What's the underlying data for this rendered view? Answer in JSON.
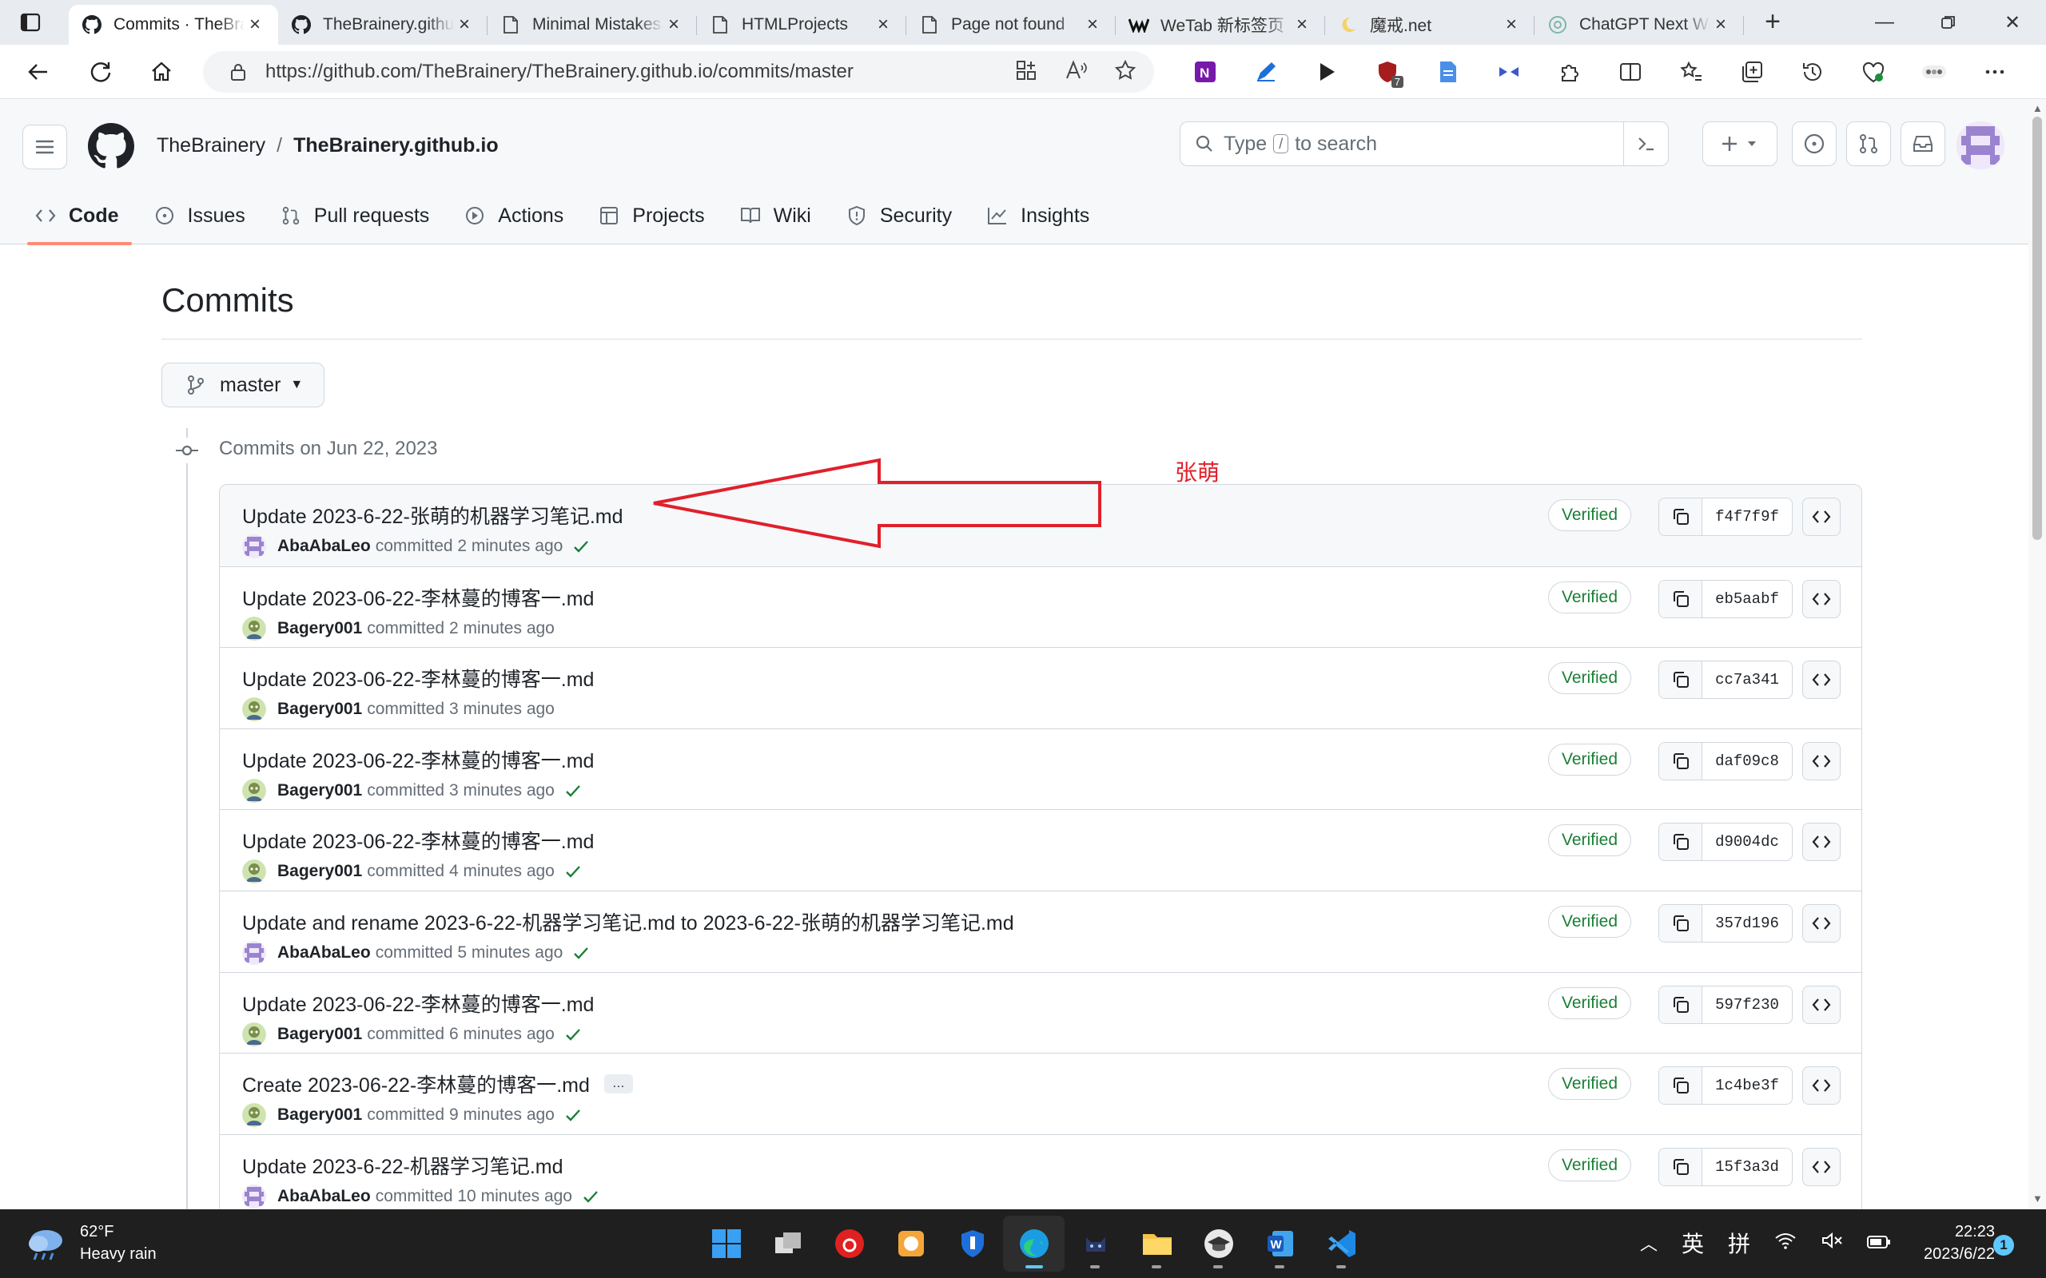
{
  "browser": {
    "tabs": [
      {
        "title": "Commits · TheBrainery/TheBrainery.github.io",
        "icon": "github-icon",
        "active": true
      },
      {
        "title": "TheBrainery.github.io",
        "icon": "github-icon",
        "active": false
      },
      {
        "title": "Minimal Mistakes",
        "icon": "page-icon",
        "active": false
      },
      {
        "title": "HTMLProjects",
        "icon": "page-icon",
        "active": false
      },
      {
        "title": "Page not found",
        "icon": "page-icon",
        "active": false
      },
      {
        "title": "WeTab 新标签页",
        "icon": "wetab-icon",
        "active": false
      },
      {
        "title": "魔戒.net",
        "icon": "moon-icon",
        "active": false
      },
      {
        "title": "ChatGPT Next Web",
        "icon": "chatgpt-icon",
        "active": false
      }
    ],
    "url": "https://github.com/TheBrainery/TheBrainery.github.io/commits/master",
    "extension_badge": "7"
  },
  "github": {
    "owner": "TheBrainery",
    "separator": "/",
    "repo": "TheBrainery.github.io",
    "search": {
      "prefix": "Type",
      "key": "/",
      "suffix": "to search"
    },
    "nav": [
      {
        "label": "Code",
        "icon": "code-icon",
        "active": true
      },
      {
        "label": "Issues",
        "icon": "issue-icon",
        "active": false
      },
      {
        "label": "Pull requests",
        "icon": "pull-request-icon",
        "active": false
      },
      {
        "label": "Actions",
        "icon": "play-icon",
        "active": false
      },
      {
        "label": "Projects",
        "icon": "table-icon",
        "active": false
      },
      {
        "label": "Wiki",
        "icon": "book-icon",
        "active": false
      },
      {
        "label": "Security",
        "icon": "shield-icon",
        "active": false
      },
      {
        "label": "Insights",
        "icon": "graph-icon",
        "active": false
      }
    ]
  },
  "page": {
    "title": "Commits",
    "branch": "master",
    "date_heading": "Commits on Jun 22, 2023",
    "annotation_label": "张萌"
  },
  "commits": [
    {
      "message": "Update 2023-6-22-张萌的机器学习笔记.md",
      "author": "AbaAbaLeo",
      "time": "committed 2 minutes ago",
      "check": true,
      "verified": "Verified",
      "sha": "f4f7f9f",
      "more": false
    },
    {
      "message": "Update 2023-06-22-李林蔓的博客一.md",
      "author": "Bagery001",
      "time": "committed 2 minutes ago",
      "check": false,
      "verified": "Verified",
      "sha": "eb5aabf",
      "more": false
    },
    {
      "message": "Update 2023-06-22-李林蔓的博客一.md",
      "author": "Bagery001",
      "time": "committed 3 minutes ago",
      "check": false,
      "verified": "Verified",
      "sha": "cc7a341",
      "more": false
    },
    {
      "message": "Update 2023-06-22-李林蔓的博客一.md",
      "author": "Bagery001",
      "time": "committed 3 minutes ago",
      "check": true,
      "verified": "Verified",
      "sha": "daf09c8",
      "more": false
    },
    {
      "message": "Update 2023-06-22-李林蔓的博客一.md",
      "author": "Bagery001",
      "time": "committed 4 minutes ago",
      "check": true,
      "verified": "Verified",
      "sha": "d9004dc",
      "more": false
    },
    {
      "message": "Update and rename 2023-6-22-机器学习笔记.md to 2023-6-22-张萌的机器学习笔记.md",
      "author": "AbaAbaLeo",
      "time": "committed 5 minutes ago",
      "check": true,
      "verified": "Verified",
      "sha": "357d196",
      "more": false
    },
    {
      "message": "Update 2023-06-22-李林蔓的博客一.md",
      "author": "Bagery001",
      "time": "committed 6 minutes ago",
      "check": true,
      "verified": "Verified",
      "sha": "597f230",
      "more": false
    },
    {
      "message": "Create 2023-06-22-李林蔓的博客一.md",
      "author": "Bagery001",
      "time": "committed 9 minutes ago",
      "check": true,
      "verified": "Verified",
      "sha": "1c4be3f",
      "more": true,
      "more_label": "…"
    },
    {
      "message": "Update 2023-6-22-机器学习笔记.md",
      "author": "AbaAbaLeo",
      "time": "committed 10 minutes ago",
      "check": true,
      "verified": "Verified",
      "sha": "15f3a3d",
      "more": false
    }
  ],
  "taskbar": {
    "weather_temp": "62°F",
    "weather_desc": "Heavy rain",
    "tray_ime_1": "英",
    "tray_ime_2": "拼",
    "time": "22:23",
    "date": "2023/6/22",
    "notifications": "1"
  },
  "colors": {
    "accent_orange": "#fd8c73",
    "verified_green": "#1a7f37",
    "annotation_red": "#e0202b",
    "taskbar_bg": "#1f1f1f"
  }
}
